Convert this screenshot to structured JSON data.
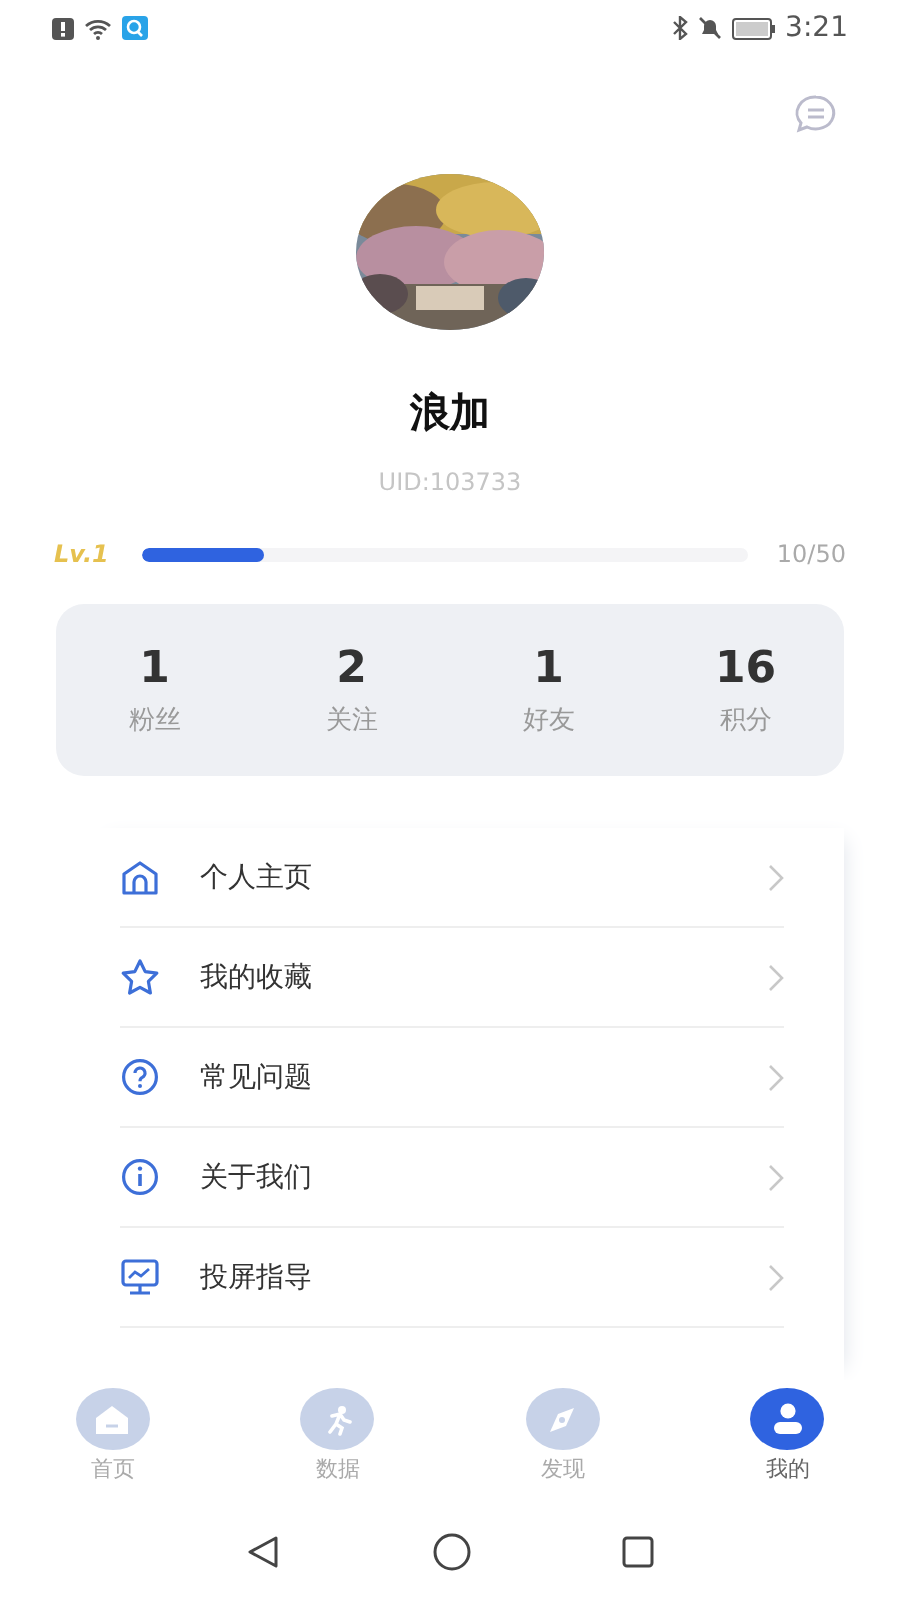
{
  "status_bar": {
    "time": "3:21"
  },
  "profile": {
    "name": "浪加",
    "uid": "UID:103733",
    "level_label": "Lv.1",
    "level": 0.2,
    "progress": "10/50"
  },
  "stats": [
    {
      "value": "1",
      "label": "粉丝"
    },
    {
      "value": "2",
      "label": "关注"
    },
    {
      "value": "1",
      "label": "好友"
    },
    {
      "value": "16",
      "label": "积分"
    }
  ],
  "menu": [
    {
      "kind": "home",
      "label": "个人主页"
    },
    {
      "kind": "star",
      "label": "我的收藏"
    },
    {
      "kind": "question",
      "label": "常见问题"
    },
    {
      "kind": "info",
      "label": "关于我们"
    },
    {
      "kind": "screen",
      "label": "投屏指导"
    }
  ],
  "tabs": [
    {
      "kind": "home",
      "label": "首页",
      "selected": false
    },
    {
      "kind": "run",
      "label": "数据",
      "selected": false
    },
    {
      "kind": "compass",
      "label": "发现",
      "selected": false
    },
    {
      "kind": "user",
      "label": "我的",
      "selected": true
    }
  ]
}
